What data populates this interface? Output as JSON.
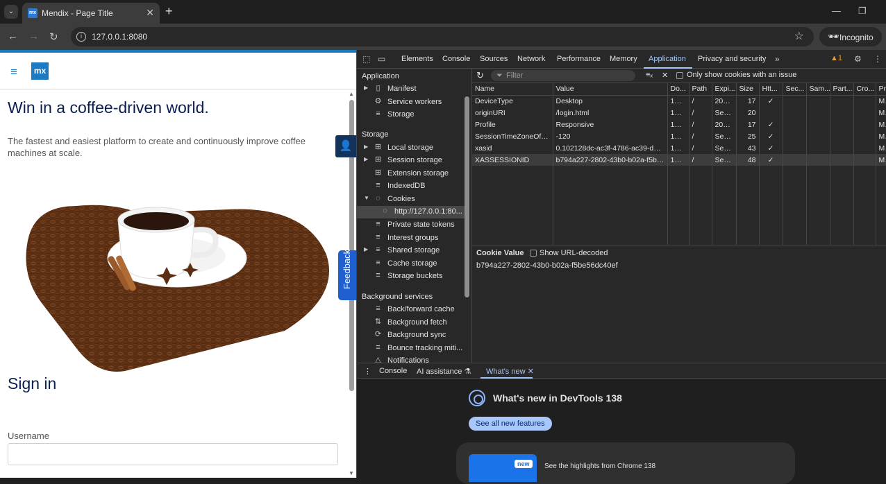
{
  "browser": {
    "tab_title": "Mendix - Page Title",
    "tab_favicon": "mx",
    "url": "127.0.0.1:8080",
    "incognito_label": "Incognito"
  },
  "page": {
    "logo": "mx",
    "hero_title": "Win in a coffee-driven world.",
    "hero_subtitle": "The fastest and easiest platform to create and continuously improve coffee machines at scale.",
    "signin_title": "Sign in",
    "username_label": "Username",
    "feedback_label": "Feedback"
  },
  "devtools": {
    "tabs": [
      "Elements",
      "Console",
      "Sources",
      "Network",
      "Performance",
      "Memory",
      "Application",
      "Privacy and security"
    ],
    "active_tab": "Application",
    "warning_count": "1",
    "sidebar": {
      "application_header": "Application",
      "application_items": [
        "Manifest",
        "Service workers",
        "Storage"
      ],
      "storage_header": "Storage",
      "storage_items": [
        "Local storage",
        "Session storage",
        "Extension storage",
        "IndexedDB",
        "Cookies",
        "http://127.0.0.1:80...",
        "Private state tokens",
        "Interest groups",
        "Shared storage",
        "Cache storage",
        "Storage buckets"
      ],
      "background_header": "Background services",
      "background_items": [
        "Back/forward cache",
        "Background fetch",
        "Background sync",
        "Bounce tracking miti...",
        "Notifications"
      ]
    },
    "filter_placeholder": "Filter",
    "only_issues_label": "Only show cookies with an issue",
    "columns": [
      "Name",
      "Value",
      "Do...",
      "Path",
      "Expi...",
      "Size",
      "Htt...",
      "Sec...",
      "Sam...",
      "Part...",
      "Cro...",
      "Pr"
    ],
    "rows": [
      {
        "name": "DeviceType",
        "value": "Desktop",
        "domain": "127....",
        "path": "/",
        "expires": "202...",
        "size": "17",
        "http": "✓",
        "pr": "M"
      },
      {
        "name": "originURI",
        "value": "/login.html",
        "domain": "127....",
        "path": "/",
        "expires": "Sess...",
        "size": "20",
        "http": "",
        "pr": "M"
      },
      {
        "name": "Profile",
        "value": "Responsive",
        "domain": "127....",
        "path": "/",
        "expires": "202...",
        "size": "17",
        "http": "✓",
        "pr": "M"
      },
      {
        "name": "SessionTimeZoneOffset",
        "value": "-120",
        "domain": "127....",
        "path": "/",
        "expires": "Sess...",
        "size": "25",
        "http": "✓",
        "pr": "M"
      },
      {
        "name": "xasid",
        "value": "0.102128dc-ac3f-4786-ac39-dba...",
        "domain": "127....",
        "path": "/",
        "expires": "Sess...",
        "size": "43",
        "http": "✓",
        "pr": "M"
      },
      {
        "name": "XASSESSIONID",
        "value": "b794a227-2802-43b0-b02a-f5be...",
        "domain": "127....",
        "path": "/",
        "expires": "Sess...",
        "size": "48",
        "http": "✓",
        "pr": "M"
      }
    ],
    "cookie_value_title": "Cookie Value",
    "show_url_decoded": "Show URL-decoded",
    "cookie_value": "b794a227-2802-43b0-b02a-f5be56dc40ef",
    "bottom_tabs": [
      "Console",
      "AI assistance",
      "What's new"
    ],
    "whats_new_title": "What's new in DevTools 138",
    "see_all_label": "See all new features",
    "new_badge": "new",
    "highlights_text": "See the highlights from Chrome 138"
  }
}
